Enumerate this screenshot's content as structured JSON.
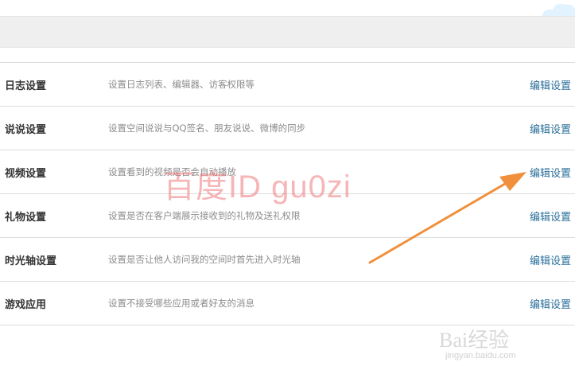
{
  "settings": [
    {
      "name": "日志设置",
      "desc": "设置日志列表、编辑器、访客权限等",
      "action": "编辑设置"
    },
    {
      "name": "说说设置",
      "desc": "设置空间说说与QQ签名、朋友说说、微博的同步",
      "action": "编辑设置"
    },
    {
      "name": "视频设置",
      "desc": "设置看到的视频是否会自动播放",
      "action": "编辑设置"
    },
    {
      "name": "礼物设置",
      "desc": "设置是否在客户端展示接收到的礼物及送礼权限",
      "action": "编辑设置"
    },
    {
      "name": "时光轴设置",
      "desc": "设置是否让他人访问我的空间时首先进入时光轴",
      "action": "编辑设置"
    },
    {
      "name": "游戏应用",
      "desc": "设置不接受哪些应用或者好友的消息",
      "action": "编辑设置"
    }
  ],
  "watermark": "百度ID gu0zi",
  "baidu_logo": {
    "text": "Bai经验",
    "sub": "jingyan.baidu.com"
  },
  "colors": {
    "action_link": "#2b6f9a",
    "arrow": "#f0903c",
    "watermark": "#ef6f73"
  }
}
